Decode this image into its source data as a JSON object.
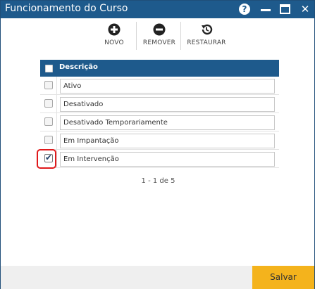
{
  "window": {
    "title": "Funcionamento do Curso",
    "colors": {
      "titlebar": "#1e5a8c",
      "save_button": "#f4b31c",
      "selection_highlight": "#e0191b"
    }
  },
  "titlebar_controls": {
    "help": "?",
    "close": "✕"
  },
  "toolbar": {
    "novo_label": "NOVO",
    "remover_label": "REMOVER",
    "restaurar_label": "RESTAURAR"
  },
  "grid": {
    "header_label": "Descrição",
    "rows": [
      {
        "label": "Ativo",
        "checked": false
      },
      {
        "label": "Desativado",
        "checked": false
      },
      {
        "label": "Desativado Temporariamente",
        "checked": false
      },
      {
        "label": "Em Impantação",
        "checked": false
      },
      {
        "label": "Em Intervenção",
        "checked": true
      }
    ]
  },
  "pager": {
    "text": "1 - 1 de 5"
  },
  "footer": {
    "save_label": "Salvar"
  }
}
